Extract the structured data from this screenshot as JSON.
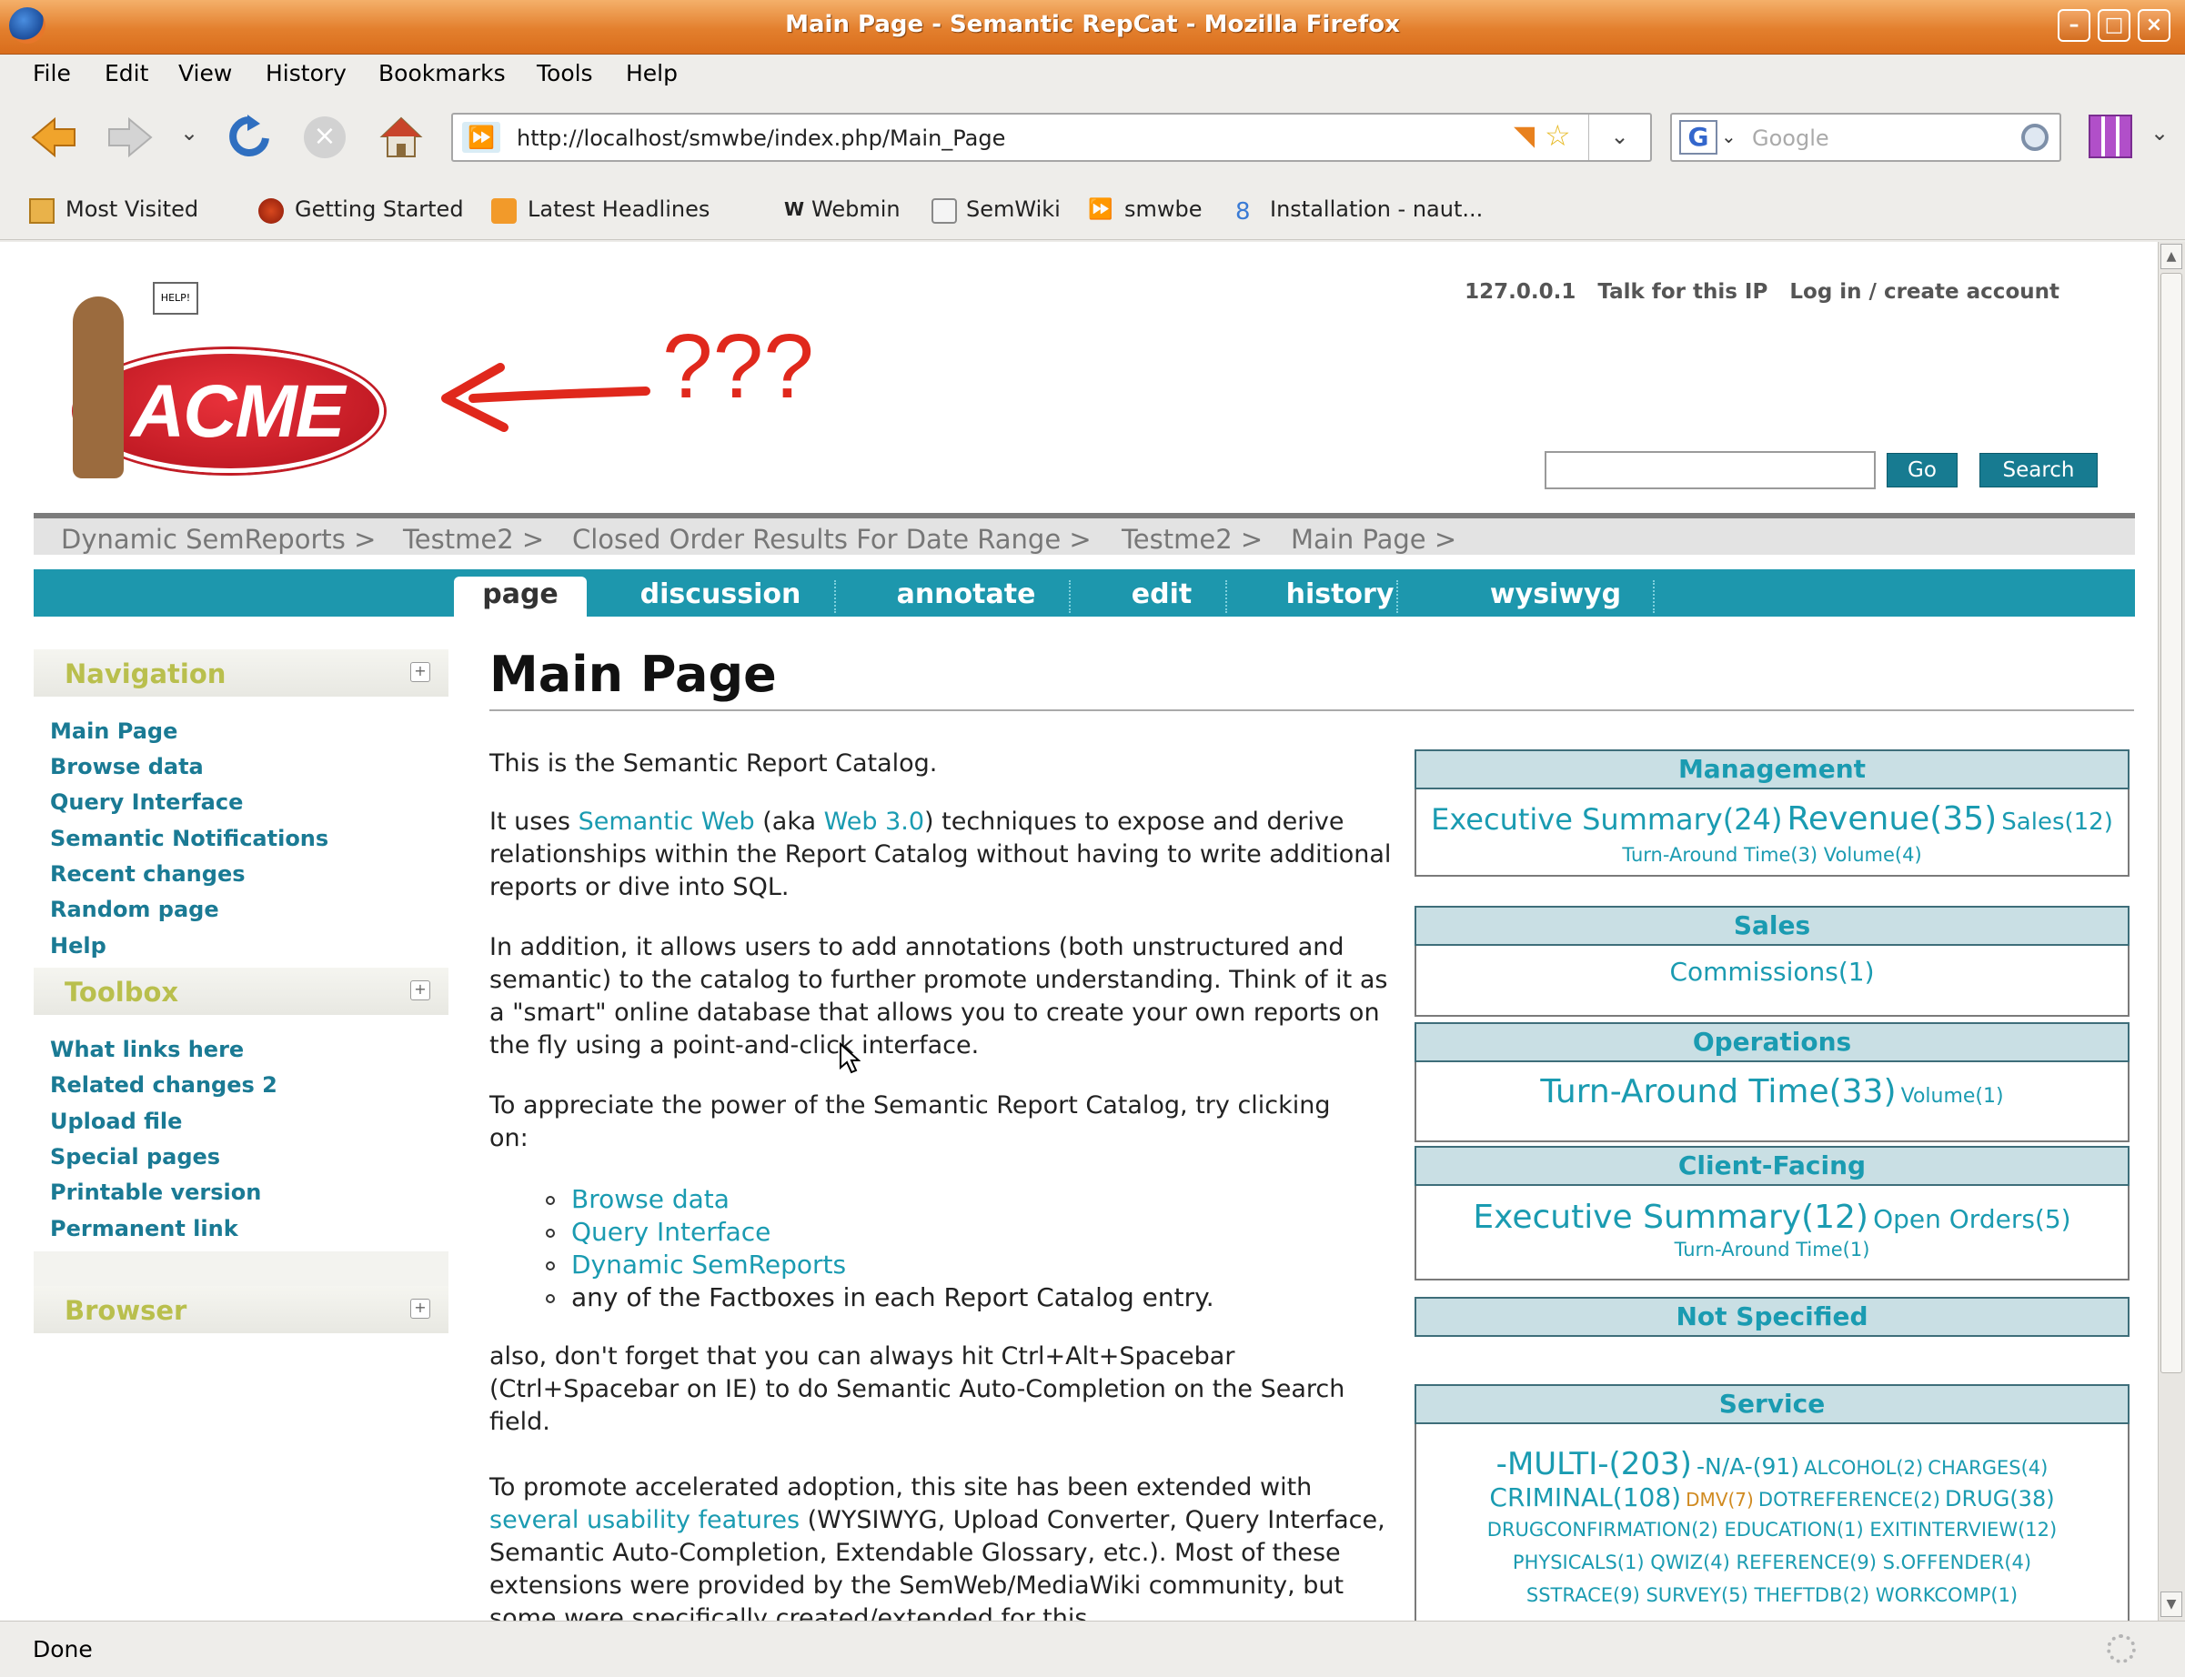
{
  "window": {
    "title": "Main Page - Semantic RepCat - Mozilla Firefox"
  },
  "menu": [
    "File",
    "Edit",
    "View",
    "History",
    "Bookmarks",
    "Tools",
    "Help"
  ],
  "url": "http://localhost/smwbe/index.php/Main_Page",
  "search_engine_placeholder": "Google",
  "bookmarks": [
    "Most Visited",
    "Getting Started",
    "Latest Headlines",
    "Webmin",
    "SemWiki",
    "smwbe",
    "Installation - naut..."
  ],
  "annotation": "???",
  "logo_text": "ACME",
  "logo_sign": "HELP!",
  "user_links": [
    "127.0.0.1",
    "Talk for this IP",
    "Log in / create account"
  ],
  "search_buttons": {
    "go": "Go",
    "search": "Search"
  },
  "breadcrumbs": [
    "Dynamic SemReports >",
    "Testme2 >",
    "Closed Order Results For Date Range >",
    "Testme2 >",
    "Main Page >"
  ],
  "tabs": [
    "page",
    "discussion",
    "annotate",
    "edit",
    "history",
    "wysiwyg"
  ],
  "sidebar": {
    "navigation_title": "Navigation",
    "navigation": [
      "Main Page",
      "Browse data",
      "Query Interface",
      "Semantic Notifications",
      "Recent changes",
      "Random page",
      "Help"
    ],
    "toolbox_title": "Toolbox",
    "toolbox": [
      "What links here",
      "Related changes 2",
      "Upload file",
      "Special pages",
      "Printable version",
      "Permanent link"
    ],
    "browser_title": "Browser"
  },
  "page": {
    "title": "Main Page",
    "p1": "This is the Semantic Report Catalog.",
    "p2_a": "It uses ",
    "p2_link1": "Semantic Web",
    "p2_b": " (aka ",
    "p2_link2": "Web 3.0",
    "p2_c": ") techniques to expose and derive relationships within the Report Catalog without having to write additional reports or dive into SQL.",
    "p3": "In addition, it allows users to add annotations (both unstructured and semantic) to the catalog to further promote understanding. Think of it as a \"smart\" online database that allows you to create your own reports on the fly using a point-and-click interface.",
    "p4": "To appreciate the power of the Semantic Report Catalog, try clicking on:",
    "list": [
      "Browse data",
      "Query Interface",
      "Dynamic SemReports"
    ],
    "list_last": "any of the Factboxes in each Report Catalog entry.",
    "p5": "also, don't forget that you can always hit Ctrl+Alt+Spacebar (Ctrl+Spacebar on IE) to do Semantic Auto-Completion on the Search field.",
    "p6_a": "To promote accelerated adoption, this site has been extended with ",
    "p6_link": "several usability features",
    "p6_b": " (WYSIWYG, Upload Converter, Query Interface, Semantic Auto-Completion, Extendable Glossary, etc.). Most of these extensions were provided by the SemWeb/MediaWiki community, but some were specifically created/extended for this"
  },
  "categories": {
    "management": {
      "title": "Management",
      "l1a": "Executive Summary(24)",
      "l1b": "Revenue(35)",
      "l1c": "Sales(12)",
      "l2": "Turn-Around Time(3) Volume(4)"
    },
    "sales": {
      "title": "Sales",
      "l1": "Commissions(1)"
    },
    "operations": {
      "title": "Operations",
      "l1a": "Turn-Around Time(33)",
      "l1b": "Volume(1)"
    },
    "client": {
      "title": "Client-Facing",
      "l1a": "Executive Summary(12)",
      "l1b": "Open Orders(5)",
      "l2": "Turn-Around Time(1)"
    },
    "notspecified": {
      "title": "Not Specified"
    },
    "service": {
      "title": "Service",
      "r1a": "-MULTI-(203)",
      "r1b": "-N/A-(91)",
      "r1c": "ALCOHOL(2)",
      "r1d": "CHARGES(4)",
      "r2a": "CRIMINAL(108)",
      "r2b": "DMV(7)",
      "r2c": "DOTREFERENCE(2)",
      "r2d": "DRUG(38)",
      "r3": "DRUGCONFIRMATION(2) EDUCATION(1) EXITINTERVIEW(12)",
      "r4": "PHYSICALS(1) QWIZ(4) REFERENCE(9) S.OFFENDER(4)",
      "r5": "SSTRACE(9) SURVEY(5) THEFTDB(2) WORKCOMP(1)"
    }
  },
  "status": "Done"
}
